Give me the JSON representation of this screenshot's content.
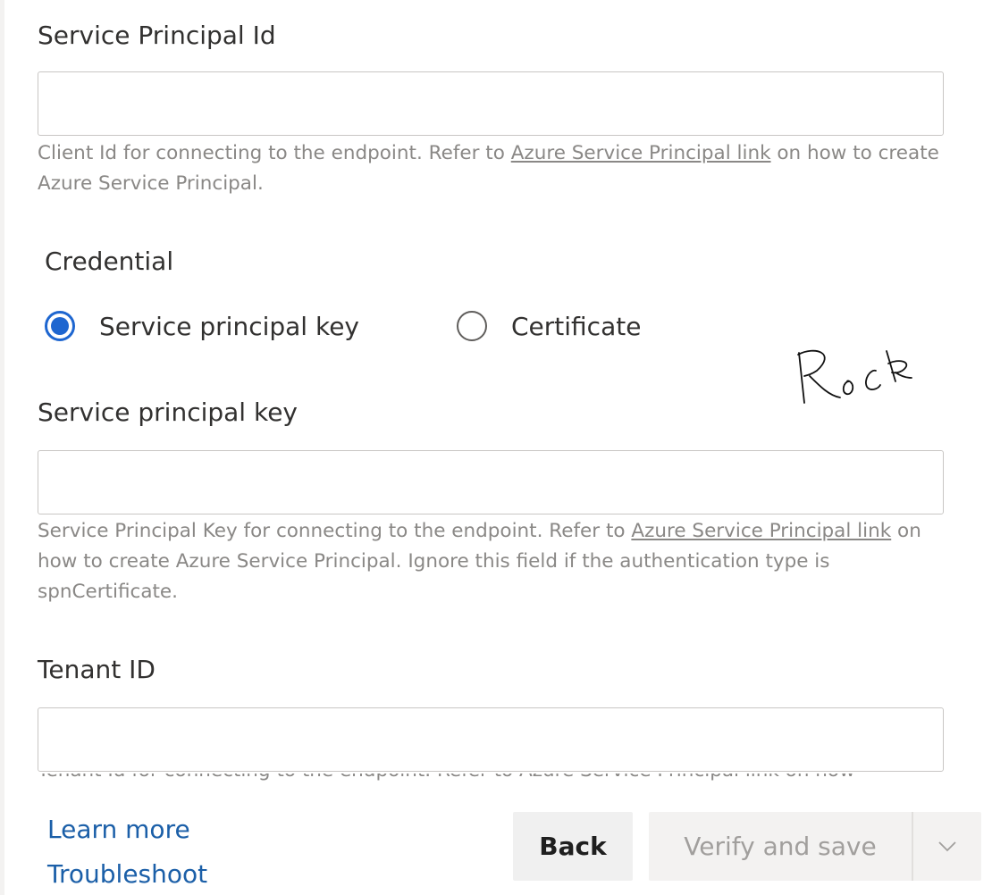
{
  "form": {
    "service_principal_id": {
      "label": "Service Principal Id",
      "value": "",
      "helper_prefix": "Client Id for connecting to the endpoint. Refer to ",
      "helper_link": "Azure Service Principal link",
      "helper_suffix": " on how to create Azure Service Principal."
    },
    "credential": {
      "label": "Credential",
      "options": [
        {
          "label": "Service principal key",
          "selected": true
        },
        {
          "label": "Certificate",
          "selected": false
        }
      ]
    },
    "service_principal_key": {
      "label": "Service principal key",
      "value": "",
      "helper_prefix": "Service Principal Key for connecting to the endpoint. Refer to ",
      "helper_link": "Azure Service Principal link",
      "helper_suffix": " on how to create Azure Service Principal. Ignore this field if the authentication type is spnCertificate."
    },
    "tenant_id": {
      "label": "Tenant ID",
      "value": "",
      "helper_partial": "Tenant Id for connecting to the endpoint. Refer to Azure Service Principal link on how"
    }
  },
  "footer": {
    "learn_more": "Learn more",
    "troubleshoot": "Troubleshoot",
    "back": "Back",
    "verify_and_save": "Verify and save"
  },
  "annotation": {
    "handwritten_text": "Rock"
  },
  "colors": {
    "accent": "#1e66d0",
    "link": "#1b5fa8",
    "helper_text": "#8a8886",
    "disabled_text": "#a19f9d",
    "input_border": "#c8c6c4"
  },
  "icons": {
    "dropdown": "chevron-down-icon",
    "radio_selected": "radio-selected-icon",
    "radio_unselected": "radio-unselected-icon"
  }
}
